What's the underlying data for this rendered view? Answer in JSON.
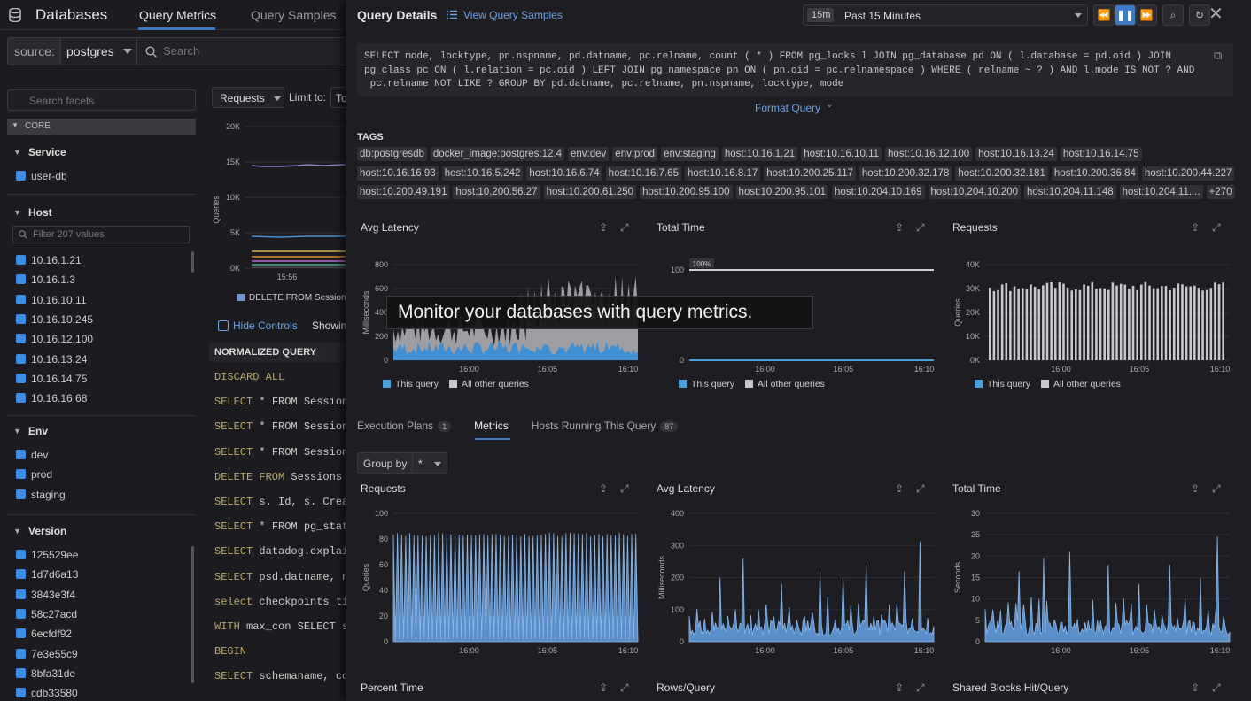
{
  "nav": {
    "title": "Databases",
    "tabs": [
      "Query Metrics",
      "Query Samples"
    ]
  },
  "source": {
    "label": "source:",
    "value": "postgres",
    "placeholder": "Search"
  },
  "facets": {
    "search_placeholder": "Search facets",
    "core": "CORE",
    "service": {
      "title": "Service",
      "items": [
        "user-db"
      ]
    },
    "host": {
      "title": "Host",
      "filter_placeholder": "Filter 207 values",
      "items": [
        "10.16.1.21",
        "10.16.1.3",
        "10.16.10.11",
        "10.16.10.245",
        "10.16.12.100",
        "10.16.13.24",
        "10.16.14.75",
        "10.16.16.68"
      ]
    },
    "env": {
      "title": "Env",
      "items": [
        "dev",
        "prod",
        "staging"
      ]
    },
    "version": {
      "title": "Version",
      "items": [
        "125529ee",
        "1d7d6a13",
        "3843e3f4",
        "58c27acd",
        "6ecfdf92",
        "7e3e55c9",
        "8bfa31de",
        "cdb33580"
      ]
    }
  },
  "mid": {
    "requests_select": "Requests",
    "limit_label": "Limit to:",
    "limit_value": "To",
    "chart": {
      "y_ticks": [
        "20K",
        "15K",
        "10K",
        "5K",
        "0K"
      ],
      "y_label": "Queries",
      "x_tick": "15:56",
      "legend": "DELETE FROM Sessions W"
    },
    "hide_controls": "Hide Controls",
    "showing": "Showin",
    "nq_header": "NORMALIZED QUERY",
    "queries": [
      [
        "DISCARD ALL",
        ""
      ],
      [
        "SELECT",
        " * FROM Sessions"
      ],
      [
        "SELECT",
        " * FROM Sessions"
      ],
      [
        "SELECT",
        " * FROM Sessions"
      ],
      [
        "DELETE FROM",
        " Sessions W"
      ],
      [
        "SELECT",
        " s. Id, s. Creat"
      ],
      [
        "SELECT",
        " * FROM pg_stat_"
      ],
      [
        "SELECT",
        " datadog.explain"
      ],
      [
        "SELECT",
        " psd.datname, nu"
      ],
      [
        "select",
        " checkpoints_tim"
      ],
      [
        "WITH",
        " max_con SELECT se"
      ],
      [
        "BEGIN",
        ""
      ],
      [
        "SELECT",
        " schemaname, cou"
      ]
    ]
  },
  "panel": {
    "title": "Query Details",
    "view_samples": "View Query Samples",
    "time": {
      "badge": "15m",
      "label": "Past 15 Minutes"
    },
    "sql": [
      "SELECT mode, locktype, pn.nspname, pd.datname, pc.relname, count ( * ) FROM pg_locks l JOIN pg_database pd ON ( l.database = pd.oid ) JOIN",
      "pg_class pc ON ( l.relation = pc.oid ) LEFT JOIN pg_namespace pn ON ( pn.oid = pc.relnamespace ) WHERE ( relname ~ ? ) AND l.mode IS NOT ? AND",
      " pc.relname NOT LIKE ? GROUP BY pd.datname, pc.relname, pn.nspname, locktype, mode"
    ],
    "format_query": "Format Query",
    "tags_label": "TAGS",
    "tags": [
      [
        "db:postgresdb",
        "docker_image:postgres:12.4",
        "env:dev",
        "env:prod",
        "env:staging",
        "host:10.16.1.21",
        "host:10.16.10.11",
        "host:10.16.12.100",
        "host:10.16.13.24",
        "host:10.16.14.75"
      ],
      [
        "host:10.16.16.93",
        "host:10.16.5.242",
        "host:10.16.6.74",
        "host:10.16.7.65",
        "host:10.16.8.17",
        "host:10.200.25.117",
        "host:10.200.32.178",
        "host:10.200.32.181",
        "host:10.200.36.84",
        "host:10.200.44.227"
      ],
      [
        "host:10.200.49.191",
        "host:10.200.56.27",
        "host:10.200.61.250",
        "host:10.200.95.100",
        "host:10.200.95.101",
        "host:10.204.10.169",
        "host:10.204.10.200",
        "host:10.204.11.148",
        "host:10.204.11....",
        "+270"
      ]
    ],
    "legend": {
      "this": "This query",
      "others": "All other queries"
    },
    "subtabs": [
      {
        "label": "Execution Plans",
        "count": "1"
      },
      {
        "label": "Metrics",
        "count": ""
      },
      {
        "label": "Hosts Running This Query",
        "count": "87"
      }
    ],
    "group_by": {
      "label": "Group by",
      "value": "*"
    },
    "bottom_titles": [
      "Percent Time",
      "Rows/Query",
      "Shared Blocks Hit/Query"
    ],
    "caption": "Monitor your databases with query metrics."
  },
  "chart_data": [
    {
      "type": "area",
      "title": "Avg Latency",
      "ylabel": "Milliseconds",
      "ylim": [
        0,
        800
      ],
      "y_ticks": [
        "800",
        "600",
        "400",
        "200",
        "0"
      ],
      "x_ticks": [
        "16:00",
        "16:05",
        "16:10"
      ],
      "series": [
        {
          "name": "This query",
          "color": "#4d9fdc",
          "approx_range": [
            0,
            150
          ]
        },
        {
          "name": "All other queries",
          "color": "#c8c8c8",
          "approx_range": [
            100,
            700
          ]
        }
      ]
    },
    {
      "type": "line",
      "title": "Total Time",
      "ylabel": "",
      "ylim": [
        0,
        100
      ],
      "y_ticks": [
        "100",
        "0"
      ],
      "x_ticks": [
        "16:00",
        "16:05",
        "16:10"
      ],
      "annotation": "100%",
      "series": [
        {
          "name": "This query",
          "color": "#4d9fdc",
          "values_approx": 0
        },
        {
          "name": "All other queries",
          "color": "#c8c8c8",
          "values_approx": 100
        }
      ]
    },
    {
      "type": "bar",
      "title": "Requests",
      "ylabel": "Queries",
      "ylim": [
        0,
        40000
      ],
      "y_ticks": [
        "40K",
        "30K",
        "20K",
        "10K",
        "0K"
      ],
      "x_ticks": [
        "16:00",
        "16:05",
        "16:10"
      ],
      "series": [
        {
          "name": "This query",
          "color": "#4d9fdc",
          "values_approx": 0
        },
        {
          "name": "All other queries",
          "color": "#c8c8c8",
          "values_approx": 32000
        }
      ]
    },
    {
      "type": "bar",
      "title": "Requests",
      "ylabel": "Queries",
      "ylim": [
        0,
        100
      ],
      "y_ticks": [
        "100",
        "80",
        "60",
        "40",
        "20",
        "0"
      ],
      "x_ticks": [
        "16:00",
        "16:05",
        "16:10"
      ],
      "values_approx": 82
    },
    {
      "type": "area",
      "title": "Avg Latency",
      "ylabel": "Milliseconds",
      "ylim": [
        0,
        400
      ],
      "y_ticks": [
        "400",
        "300",
        "200",
        "100",
        "0"
      ],
      "x_ticks": [
        "16:00",
        "16:05",
        "16:10"
      ],
      "peak": 310
    },
    {
      "type": "area",
      "title": "Total Time",
      "ylabel": "Seconds",
      "ylim": [
        0,
        30
      ],
      "y_ticks": [
        "30",
        "25",
        "20",
        "15",
        "10",
        "5",
        "0"
      ],
      "x_ticks": [
        "16:00",
        "16:05",
        "16:10"
      ],
      "peak": 25
    }
  ]
}
